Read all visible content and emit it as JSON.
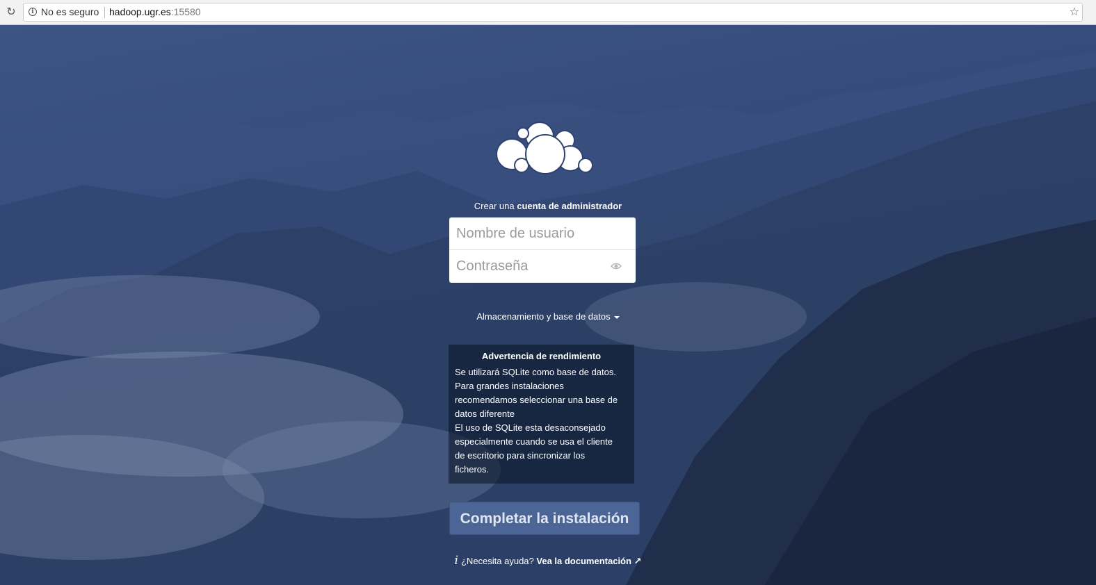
{
  "browser": {
    "security_label": "No es seguro",
    "url_host": "hadoop.ugr.es",
    "url_port": ":15580"
  },
  "setup": {
    "title_prefix": "Crear una",
    "title_bold": "cuenta de administrador",
    "username_placeholder": "Nombre de usuario",
    "password_placeholder": "Contraseña",
    "storage_label": "Almacenamiento y base de datos",
    "warning_title": "Advertencia de rendimiento",
    "warning_lines": [
      "Se utilizará SQLite como base de datos.",
      "Para grandes instalaciones",
      "recomendamos seleccionar una base de",
      "datos diferente",
      "El uso de SQLite esta desaconsejado",
      "especialmente cuando se usa el cliente",
      "de escritorio para sincronizar los",
      "ficheros."
    ],
    "submit_label": "Completar la instalación",
    "help_text": "¿Necesita ayuda?",
    "help_link": "Vea la documentación ↗",
    "help_icon": "i"
  },
  "colors": {
    "background": "#2b3a5c",
    "button": "#4a6596",
    "warning_bg": "rgba(10,18,34,0.55)"
  }
}
